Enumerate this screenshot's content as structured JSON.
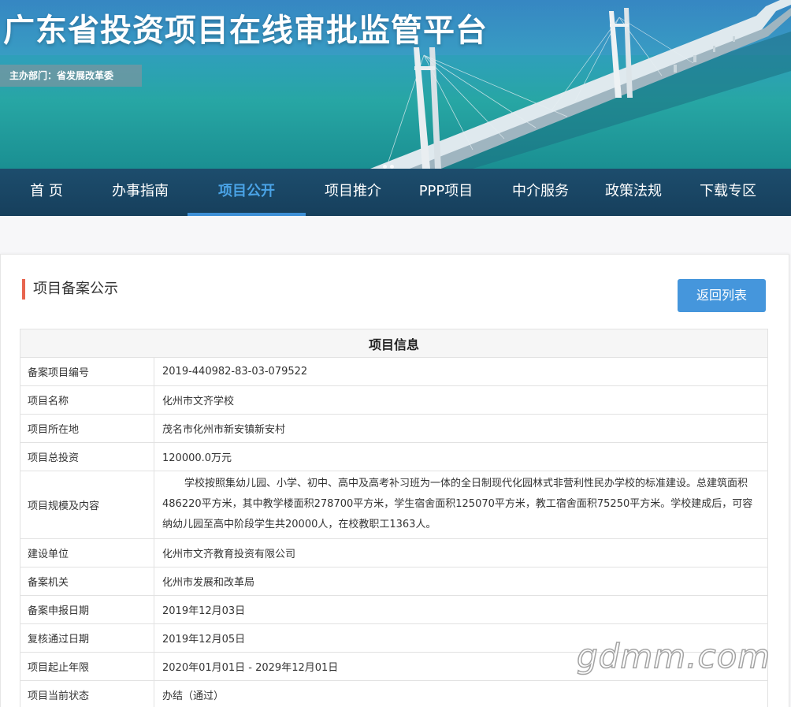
{
  "header": {
    "site_title": "广东省投资项目在线审批监管平台",
    "sponsor": "主办部门：省发展改革委"
  },
  "nav": {
    "items": [
      {
        "label": "首 页"
      },
      {
        "label": "办事指南"
      },
      {
        "label": "项目公开",
        "active": true
      },
      {
        "label": "项目推介"
      },
      {
        "label": "PPP项目"
      },
      {
        "label": "中介服务"
      },
      {
        "label": "政策法规"
      },
      {
        "label": "下载专区"
      }
    ]
  },
  "main": {
    "section_title": "项目备案公示",
    "back_button": "返回列表",
    "table": {
      "heading": "项目信息",
      "rows": [
        {
          "label": "备案项目编号",
          "value": "2019-440982-83-03-079522"
        },
        {
          "label": "项目名称",
          "value": "化州市文齐学校"
        },
        {
          "label": "项目所在地",
          "value": "茂名市化州市新安镇新安村"
        },
        {
          "label": "项目总投资",
          "value": "120000.0万元"
        },
        {
          "label": "项目规模及内容",
          "value": "学校按照集幼儿园、小学、初中、高中及高考补习班为一体的全日制现代化园林式非营利性民办学校的标准建设。总建筑面积486220平方米，其中教学楼面积278700平方米，学生宿舍面积125070平方米，教工宿舍面积75250平方米。学校建成后，可容纳幼儿园至高中阶段学生共20000人，在校教职工1363人。"
        },
        {
          "label": "建设单位",
          "value": "化州市文齐教育投资有限公司"
        },
        {
          "label": "备案机关",
          "value": "化州市发展和改革局"
        },
        {
          "label": "备案申报日期",
          "value": "2019年12月03日"
        },
        {
          "label": "复核通过日期",
          "value": "2019年12月05日"
        },
        {
          "label": "项目起止年限",
          "value": "2020年01月01日 - 2029年12月01日"
        },
        {
          "label": "项目当前状态",
          "value": "办结（通过）"
        }
      ]
    }
  },
  "watermark": "gdmm.com"
}
